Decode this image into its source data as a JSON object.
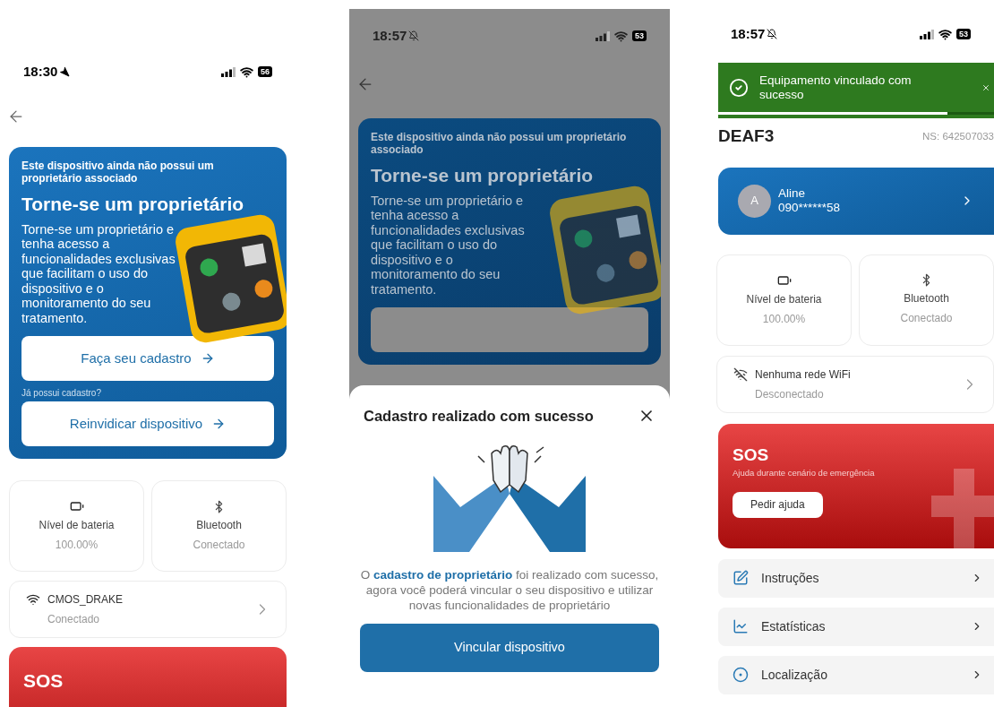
{
  "left_screen": {
    "status_bar": {
      "time": "18:30",
      "kind": "location",
      "battery": "56"
    },
    "promo_card": {
      "notice": "Este dispositivo ainda não possui um proprietário associado",
      "title": "Torne-se um proprietário",
      "body": "Torne-se um proprietário e tenha acesso a funcionalidades exclusivas que facilitam o uso do dispositivo e o monitoramento do seu tratamento.",
      "register_button": "Faça seu cadastro",
      "claim_prompt": "Já possui cadastro?",
      "claim_button": "Reinvidicar dispositivo"
    },
    "sensors": [
      {
        "kind": "battery",
        "label": "Nível de bateria",
        "value": "100.00%"
      },
      {
        "kind": "bluetooth",
        "label": "Bluetooth",
        "value": "Conectado"
      }
    ],
    "wifi": {
      "connected": true,
      "name": "CMOS_DRAKE",
      "status": "Conectado"
    },
    "sos": {
      "title": "SOS"
    }
  },
  "middle_screen": {
    "dimmed": true,
    "status_bar": {
      "time": "18:57",
      "kind": "muted",
      "battery": "53"
    },
    "promo_card": {
      "notice": "Este dispositivo ainda não possui um proprietário associado",
      "title": "Torne-se um proprietário",
      "body": "Torne-se um proprietário e tenha acesso a funcionalidades exclusivas que facilitam o uso do dispositivo e o monitoramento do seu tratamento."
    },
    "dialog": {
      "title": "Cadastro realizado com sucesso",
      "message": "O **cadastro de proprietário** foi realizado com sucesso, agora você poderá vincular o seu dispositivo e utilizar novas funcionalidades de proprietário",
      "button": "Vincular dispositivo"
    }
  },
  "right_screen": {
    "status_bar": {
      "time": "18:57",
      "kind": "muted",
      "battery": "53"
    },
    "toast": {
      "message": "Equipamento vinculado com sucesso",
      "level": 0.83
    },
    "device": {
      "name": "DEAF3",
      "serial": "NS: 642507033"
    },
    "owner": {
      "initial": "A",
      "name": "Aline",
      "phone": "090******58"
    },
    "sensors": [
      {
        "kind": "battery",
        "label": "Nível de bateria",
        "value": "100.00%"
      },
      {
        "kind": "bluetooth",
        "label": "Bluetooth",
        "value": "Conectado"
      }
    ],
    "wifi": {
      "connected": false,
      "name": "Nenhuma rede WiFi",
      "status": "Desconectado"
    },
    "sos": {
      "title": "SOS",
      "subtitle": "Ajuda durante cenário de emergência",
      "button": "Pedir ajuda"
    },
    "menu": [
      {
        "kind": "instructions",
        "label": "Instruções"
      },
      {
        "kind": "statistics",
        "label": "Estatísticas"
      },
      {
        "kind": "location",
        "label": "Localização"
      }
    ]
  }
}
